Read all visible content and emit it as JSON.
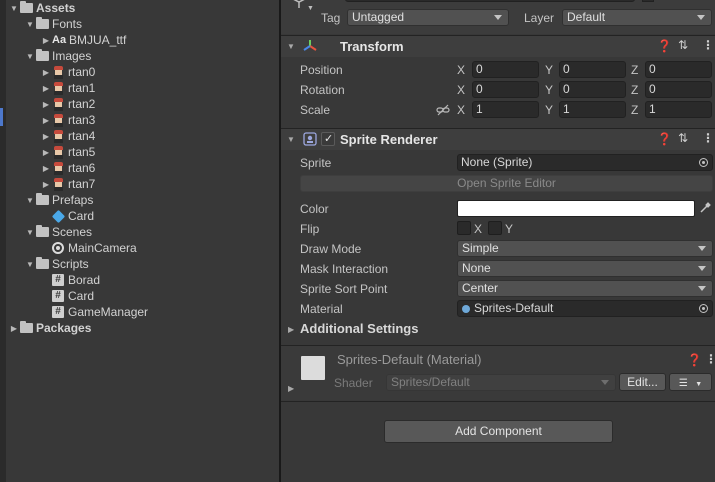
{
  "project": {
    "tree": [
      {
        "label": "Assets",
        "bold": true,
        "arrow": "▼",
        "icon": "folder"
      },
      {
        "label": "Fonts",
        "arrow": "▼",
        "icon": "folder"
      },
      {
        "label": "BMJUA_ttf",
        "arrow": "▶",
        "icon": "font",
        "icon_text": "Aa"
      },
      {
        "label": "Images",
        "arrow": "▼",
        "icon": "folder"
      },
      {
        "label": "rtan0",
        "arrow": "▶",
        "icon": "sprite"
      },
      {
        "label": "rtan1",
        "arrow": "▶",
        "icon": "sprite"
      },
      {
        "label": "rtan2",
        "arrow": "▶",
        "icon": "sprite"
      },
      {
        "label": "rtan3",
        "arrow": "▶",
        "icon": "sprite"
      },
      {
        "label": "rtan4",
        "arrow": "▶",
        "icon": "sprite"
      },
      {
        "label": "rtan5",
        "arrow": "▶",
        "icon": "sprite"
      },
      {
        "label": "rtan6",
        "arrow": "▶",
        "icon": "sprite"
      },
      {
        "label": "rtan7",
        "arrow": "▶",
        "icon": "sprite"
      },
      {
        "label": "Prefaps",
        "arrow": "▼",
        "icon": "folder"
      },
      {
        "label": "Card",
        "arrow": "",
        "icon": "prefab"
      },
      {
        "label": "Scenes",
        "arrow": "▼",
        "icon": "folder"
      },
      {
        "label": "MainCamera",
        "arrow": "",
        "icon": "camera"
      },
      {
        "label": "Scripts",
        "arrow": "▼",
        "icon": "folder"
      },
      {
        "label": "Borad",
        "arrow": "",
        "icon": "script",
        "icon_text": "#"
      },
      {
        "label": "Card",
        "arrow": "",
        "icon": "script",
        "icon_text": "#"
      },
      {
        "label": "GameManager",
        "arrow": "",
        "icon": "script",
        "icon_text": "#"
      },
      {
        "label": "Packages",
        "bold": true,
        "arrow": "▶",
        "icon": "folder"
      }
    ]
  },
  "inspector": {
    "tag_label": "Tag",
    "tag_value": "Untagged",
    "layer_label": "Layer",
    "layer_value": "Default",
    "transform": {
      "title": "Transform",
      "position_label": "Position",
      "rotation_label": "Rotation",
      "scale_label": "Scale",
      "axis_x": "X",
      "axis_y": "Y",
      "axis_z": "Z",
      "position": [
        "0",
        "0",
        "0"
      ],
      "rotation": [
        "0",
        "0",
        "0"
      ],
      "scale": [
        "1",
        "1",
        "1"
      ]
    },
    "sprite_renderer": {
      "title": "Sprite Renderer",
      "enabled_glyph": "✓",
      "sprite_label": "Sprite",
      "sprite_value": "None (Sprite)",
      "open_editor": "Open Sprite Editor",
      "color_label": "Color",
      "color_value": "#FFFFFF",
      "flip_label": "Flip",
      "flip_x": "X",
      "flip_y": "Y",
      "draw_mode_label": "Draw Mode",
      "draw_mode_value": "Simple",
      "mask_label": "Mask Interaction",
      "mask_value": "None",
      "sort_point_label": "Sprite Sort Point",
      "sort_point_value": "Center",
      "material_label": "Material",
      "material_value": "Sprites-Default",
      "additional": "Additional Settings"
    },
    "material": {
      "title": "Sprites-Default (Material)",
      "shader_label": "Shader",
      "shader_value": "Sprites/Default",
      "edit_button": "Edit..."
    },
    "add_component": "Add Component"
  }
}
